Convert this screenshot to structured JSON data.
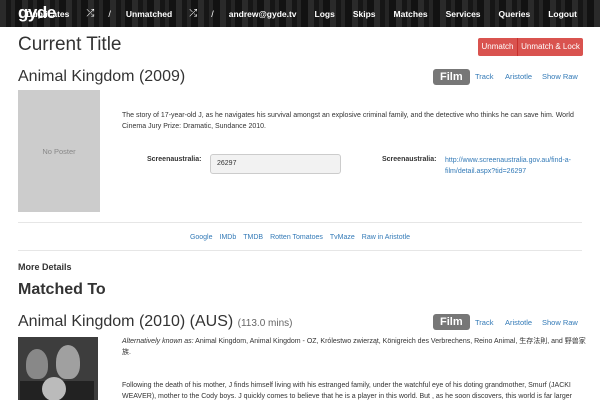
{
  "nav": {
    "brand": "gyde",
    "items": [
      "Duplicates",
      "Unmatched",
      "andrew@gyde.tv",
      "Logs",
      "Skips",
      "Matches",
      "Services",
      "Queries",
      "Logout"
    ],
    "shuffle_icon": "shuffle-icon",
    "separator": "/"
  },
  "current": {
    "heading": "Current Title",
    "unmatch_label": "Unmatch",
    "unmatch_lock_label": "Unmatch & Lock",
    "title": "Animal Kingdom (2009)",
    "type_badge": "Film",
    "links": [
      "Track",
      "Aristotle",
      "Show Raw"
    ],
    "poster_text": "No Poster",
    "synopsis": "The story of 17-year-old J, as he navigates his survival amongst an explosive criminal family, and the detective who thinks he can save him. World Cinema Jury Prize: Dramatic, Sundance 2010.",
    "field_label": "Screenaustralia:",
    "field_value": "26297",
    "url_label": "Screenaustralia:",
    "url_value": "http://www.screenaustralia.gov.au/find-a-film/detail.aspx?tid=26297",
    "external_links": [
      "Google",
      "IMDb",
      "TMDB",
      "Rotten Tomatoes",
      "TvMaze",
      "Raw in Aristotle"
    ]
  },
  "more_details": "More Details",
  "matched": {
    "heading": "Matched To",
    "title": "Animal Kingdom (2010) (AUS)",
    "runtime": "(113.0 mins)",
    "type_badge": "Film",
    "links": [
      "Track",
      "Aristotle",
      "Show Raw"
    ],
    "aka_label": "Alternatively known as:",
    "aka_text": " Animal Kingdom, Animal Kingdom - OZ, Królestwo zwierząt, Königreich des Verbrechens, Reino Animal, 生存法則, and 野兽家族.",
    "synopsis": "Following the death of his mother, J finds himself living with his estranged family, under the watchful eye of his doting grandmother, Smurf (JACKI WEAVER), mother to the Cody boys. J quickly comes to believe that he is a player in this world. But , as he soon discovers, this world is far larger"
  }
}
